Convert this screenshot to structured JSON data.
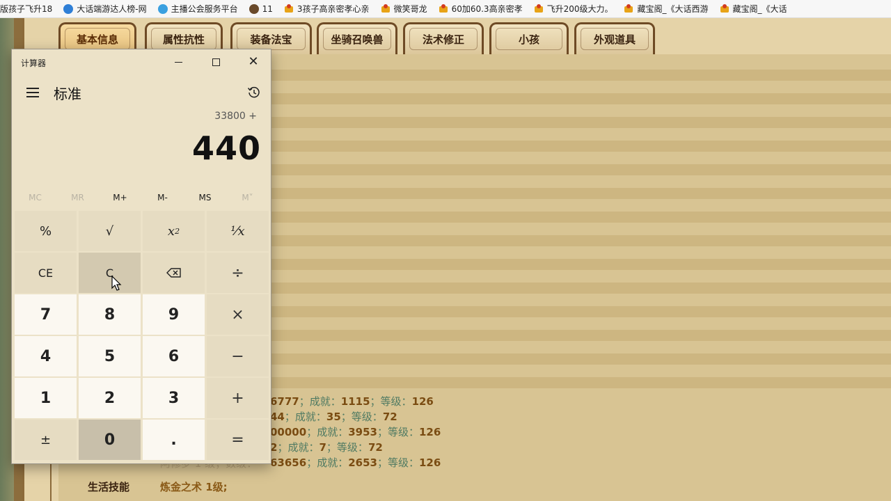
{
  "bookmarks": [
    {
      "label": "版孩子飞升18",
      "icon_color": "#d8a85a",
      "icon": "none"
    },
    {
      "label": "大话端游达人榜-网",
      "icon_color": "#2f7fd6",
      "icon": "c-logo-icon"
    },
    {
      "label": "主播公会服务平台",
      "icon_color": "#3aa0e0",
      "icon": "globe-icon"
    },
    {
      "label": "11",
      "icon_color": "#6a4a2a",
      "icon": "game-icon"
    },
    {
      "label": "3孩子高亲密孝心亲",
      "icon_color": "#e8a317",
      "icon": "fav-icon"
    },
    {
      "label": "微笑哥龙",
      "icon_color": "#e8a317",
      "icon": "fav-icon"
    },
    {
      "label": "60加60.3高亲密孝",
      "icon_color": "#e8a317",
      "icon": "fav-icon"
    },
    {
      "label": "飞升200级大力。",
      "icon_color": "#e8a317",
      "icon": "fav-icon"
    },
    {
      "label": "藏宝阁_《大话西游",
      "icon_color": "#e8a317",
      "icon": "fav-icon"
    },
    {
      "label": "藏宝阁_《大话",
      "icon_color": "#e8a317",
      "icon": "fav-icon"
    }
  ],
  "game": {
    "tabs": [
      {
        "label": "基本信息",
        "active": true
      },
      {
        "label": "属性抗性",
        "active": false
      },
      {
        "label": "装备法宝",
        "active": false
      },
      {
        "label": "坐骑召唤兽",
        "active": false
      },
      {
        "label": "法术修正",
        "active": false
      },
      {
        "label": "小孩",
        "active": false
      },
      {
        "label": "外观道具",
        "active": false
      }
    ],
    "info_rows": [
      {
        "lead": "6777",
        "achievement_label": "成就：",
        "achievement": "1115",
        "level_label": "等级：",
        "level": "126"
      },
      {
        "lead": "44",
        "achievement_label": "成就：",
        "achievement": "35",
        "level_label": "等级：",
        "level": "72"
      },
      {
        "lead": "00000",
        "achievement_label": "成就：",
        "achievement": "3953",
        "level_label": "等级：",
        "level": "126"
      },
      {
        "lead": "2",
        "achievement_label": "成就：",
        "achievement": "7",
        "level_label": "等级：",
        "level": "72"
      },
      {
        "lead": "63656",
        "achievement_label": "成就：",
        "achievement": "2653",
        "level_label": "等级：",
        "level": "126"
      }
    ],
    "faded_text": "阿修罗 1 级；数级：",
    "life_skill_label": "生活技能",
    "life_skill_value": "炼金之术 1级;"
  },
  "calculator": {
    "window_title": "计算器",
    "mode": "标准",
    "expression": "33800 +",
    "display": "440",
    "memory": [
      {
        "label": "MC",
        "enabled": false
      },
      {
        "label": "MR",
        "enabled": false
      },
      {
        "label": "M+",
        "enabled": true
      },
      {
        "label": "M-",
        "enabled": true
      },
      {
        "label": "MS",
        "enabled": true
      },
      {
        "label": "M˅",
        "enabled": false
      }
    ],
    "keys": {
      "percent": "%",
      "sqrt": "√",
      "square": "x",
      "square_sup": "2",
      "reciprocal": "¹⁄x",
      "ce": "CE",
      "c": "C",
      "backspace": "⌫",
      "divide": "÷",
      "n7": "7",
      "n8": "8",
      "n9": "9",
      "multiply": "×",
      "n4": "4",
      "n5": "5",
      "n6": "6",
      "minus": "−",
      "n1": "1",
      "n2": "2",
      "n3": "3",
      "plus": "+",
      "negate": "±",
      "n0": "0",
      "decimal": ".",
      "equals": "="
    }
  }
}
